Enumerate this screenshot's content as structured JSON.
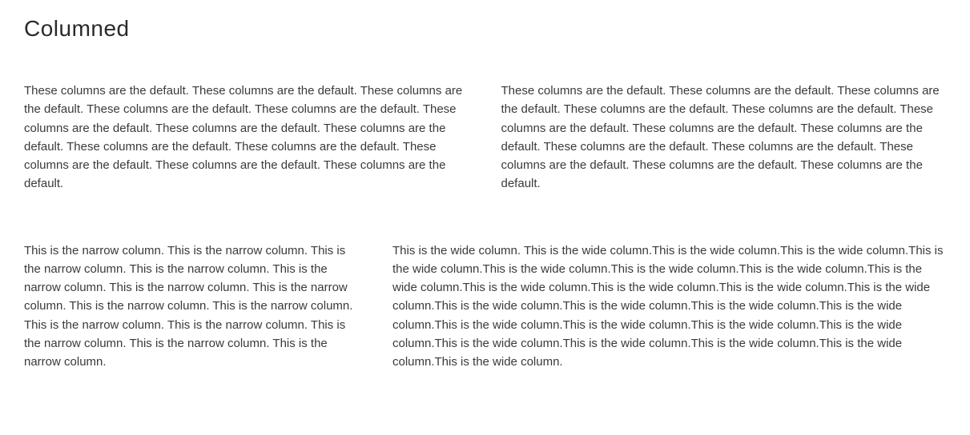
{
  "heading": "Columned",
  "row1": {
    "col1": "These columns are the default. These columns are the default. These columns are the default. These columns are the default. These columns are the default. These columns are the default. These columns are the default. These columns are the default. These columns are the default. These columns are the default. These columns are the default. These columns are the default. These columns are the default.",
    "col2": "These columns are the default. These columns are the default. These columns are the default. These columns are the default. These columns are the default. These columns are the default. These columns are the default. These columns are the default. These columns are the default. These columns are the default. These columns are the default. These columns are the default. These columns are the default."
  },
  "row2": {
    "narrow": "This is the narrow column. This is the narrow column. This is the narrow column. This is the narrow column. This is the narrow column. This is the narrow column. This is the narrow column. This is the narrow column. This is the narrow column. This is the narrow column. This is the narrow column. This is the narrow column. This is the narrow column. This is the narrow column.",
    "wide": "This is the wide column. This is the wide column.This is the wide column.This is the wide column.This is the wide column.This is the wide column.This is the wide column.This is the wide column.This is the wide column.This is the wide column.This is the wide column.This is the wide column.This is the wide column.This is the wide column.This is the wide column.This is the wide column.This is the wide column.This is the wide column.This is the wide column.This is the wide column.This is the wide column.This is the wide column.This is the wide column.This is the wide column.This is the wide column.This is the wide column."
  }
}
